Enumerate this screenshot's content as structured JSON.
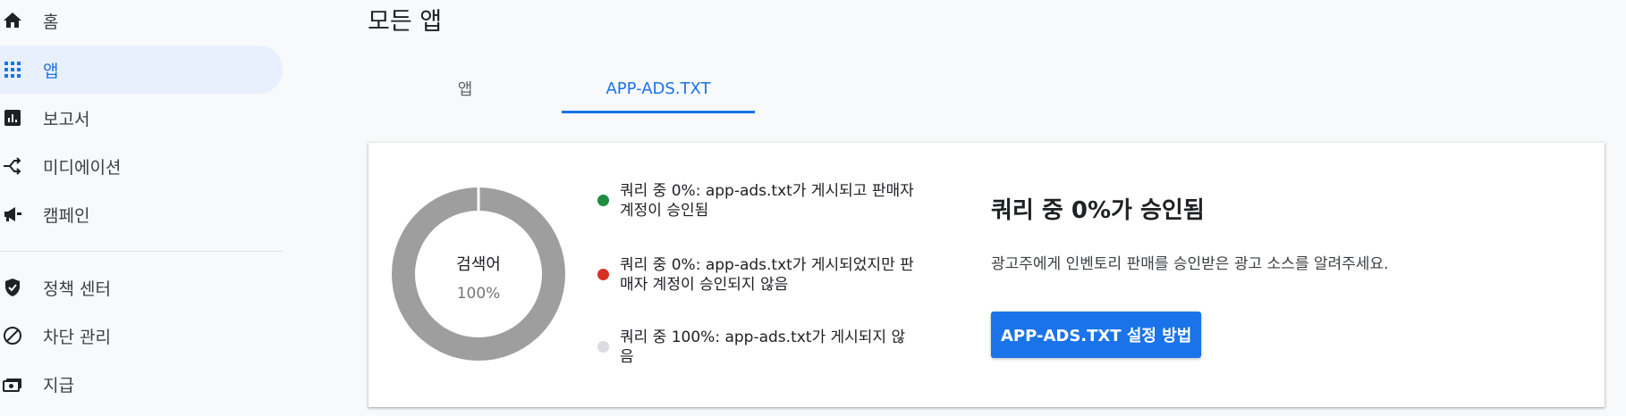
{
  "sidebar": {
    "items": [
      {
        "label": "홈",
        "icon": "home-icon"
      },
      {
        "label": "앱",
        "icon": "apps-grid-icon",
        "active": true
      },
      {
        "label": "보고서",
        "icon": "bar-chart-icon"
      },
      {
        "label": "미디에이션",
        "icon": "merge-icon"
      },
      {
        "label": "캠페인",
        "icon": "megaphone-icon"
      },
      {
        "label": "정책 센터",
        "icon": "shield-check-icon"
      },
      {
        "label": "차단 관리",
        "icon": "block-icon"
      },
      {
        "label": "지급",
        "icon": "payments-icon"
      }
    ]
  },
  "header": {
    "title": "모든 앱"
  },
  "tabs": [
    {
      "label": "앱",
      "selected": false
    },
    {
      "label": "APP-ADS.TXT",
      "selected": true
    }
  ],
  "card": {
    "donut": {
      "label": "검색어",
      "value": "100%",
      "fraction": 1.0,
      "color": "#9e9e9e"
    },
    "legend": [
      {
        "text": "쿼리 중 0%: app-ads.txt가 게시되고 판매자 계정이 승인됨",
        "color": "#1e8e3e"
      },
      {
        "text": "쿼리 중 0%: app-ads.txt가 게시되었지만 판매자 계정이 승인되지 않음",
        "color": "#d93025"
      },
      {
        "text": "쿼리 중 100%: app-ads.txt가 게시되지 않음",
        "color": "#dadce0"
      }
    ],
    "headline": "쿼리 중 0%가 승인됨",
    "description": "광고주에게 인벤토리 판매를 승인받은 광고 소스를 알려주세요.",
    "cta_label": "APP-ADS.TXT 설정 방법"
  },
  "colors": {
    "accent": "#1a73e8",
    "active_bg": "#e8f0fe"
  }
}
